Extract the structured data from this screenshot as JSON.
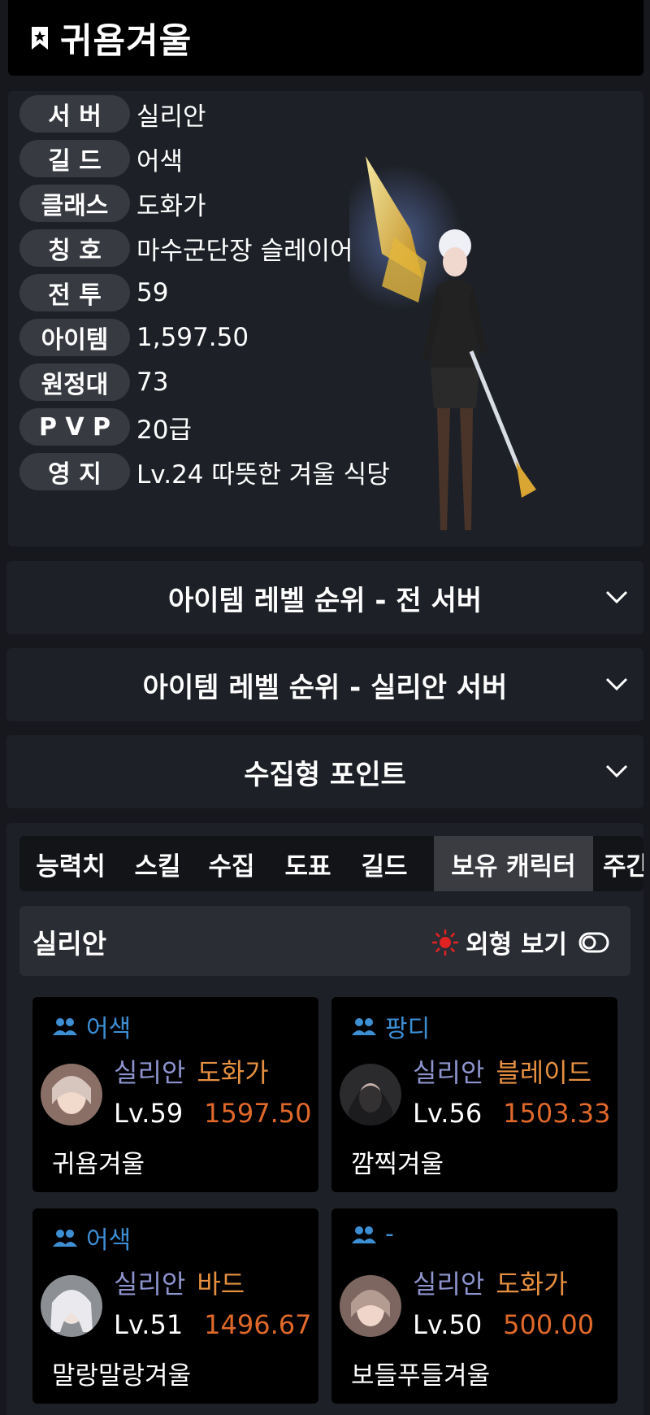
{
  "header": {
    "title": "귀욤겨울",
    "icon": "bookmark-icon"
  },
  "profile": {
    "rows": [
      {
        "label": "서 버",
        "value": "실리안"
      },
      {
        "label": "길 드",
        "value": "어색"
      },
      {
        "label": "클래스",
        "value": "도화가"
      },
      {
        "label": "칭 호",
        "value": "마수군단장 슬레이어"
      },
      {
        "label": "전 투",
        "value": "59"
      },
      {
        "label": "아이템",
        "value": "1,597.50"
      },
      {
        "label": "원정대",
        "value": "73"
      },
      {
        "label": "P V P",
        "value": "20급"
      },
      {
        "label": "영 지",
        "value": "Lv.24 따뜻한 겨울 식당"
      }
    ]
  },
  "accordions": [
    {
      "title": "아이템 레벨 순위 - 전 서버"
    },
    {
      "title": "아이템 레벨 순위 - 실리안 서버"
    },
    {
      "title": "수집형 포인트"
    }
  ],
  "tabs": [
    "능력치",
    "스킬",
    "수집",
    "도표",
    "길드",
    "보유 캐릭터",
    "주간"
  ],
  "active_tab": "보유 캐릭터",
  "server_bar": {
    "name": "실리안",
    "appearance_label": "외형 보기"
  },
  "characters": [
    {
      "guild": "어색",
      "server": "실리안",
      "class": "도화가",
      "level": "Lv.59",
      "item_level": "1597.50",
      "name": "귀욤겨울"
    },
    {
      "guild": "팡디",
      "server": "실리안",
      "class": "블레이드",
      "level": "Lv.56",
      "item_level": "1503.33",
      "name": "깜찍겨울"
    },
    {
      "guild": "어색",
      "server": "실리안",
      "class": "바드",
      "level": "Lv.51",
      "item_level": "1496.67",
      "name": "말랑말랑겨울"
    },
    {
      "guild": "-",
      "server": "실리안",
      "class": "도화가",
      "level": "Lv.50",
      "item_level": "500.00",
      "name": "보들푸들겨울"
    }
  ],
  "colors": {
    "accent_orange": "#e0692a",
    "server_purple": "#8e94ce",
    "guild_blue": "#3d8fd4",
    "class_orange": "#e59040"
  }
}
